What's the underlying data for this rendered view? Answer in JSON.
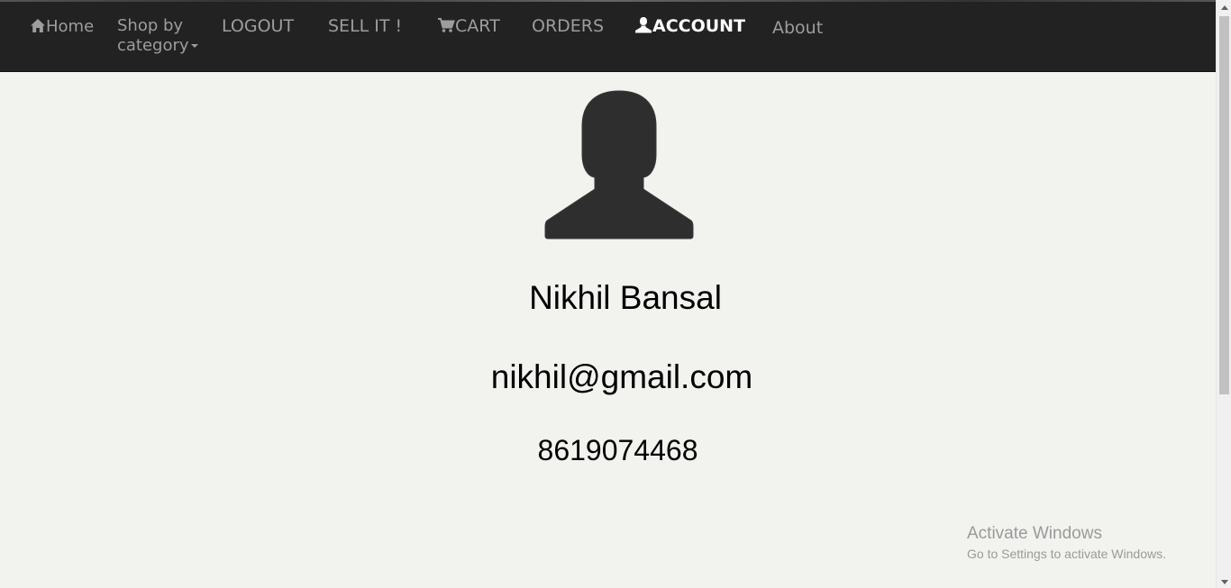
{
  "nav": {
    "home": "Home",
    "shop_line1": "Shop by",
    "shop_line2": "category",
    "logout": "LOGOUT",
    "sell": "SELL IT !",
    "cart": "CART",
    "orders": "ORDERS",
    "account": "ACCOUNT",
    "about": "About"
  },
  "icons": {
    "home": "home-icon",
    "cart": "cart-icon",
    "account": "user-icon",
    "avatar": "user-silhouette-icon"
  },
  "profile": {
    "name": "Nikhil Bansal",
    "email": "nikhil@gmail.com",
    "phone": "8619074468"
  },
  "watermark": {
    "title": "Activate Windows",
    "subtitle": "Go to Settings to activate Windows."
  },
  "colors": {
    "navbar_bg": "#222222",
    "nav_text": "#9d9d9d",
    "nav_active": "#ffffff",
    "page_bg": "#f2f3ef",
    "avatar": "#2e2e2e"
  }
}
